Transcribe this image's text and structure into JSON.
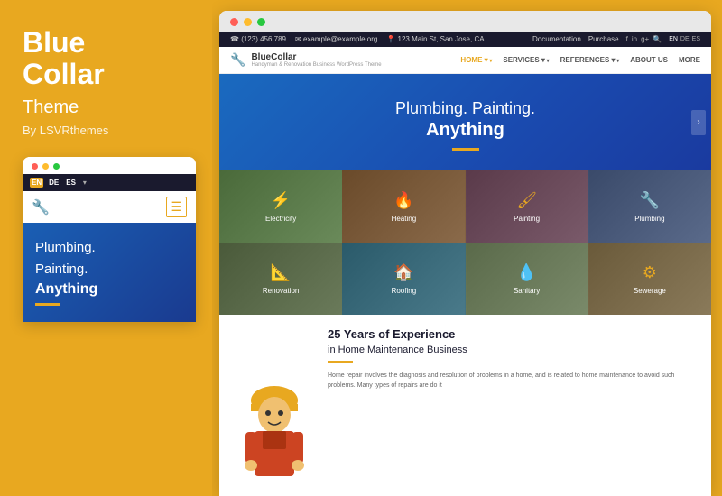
{
  "left": {
    "title_line1": "Blue",
    "title_line2": "Collar",
    "subtitle": "Theme",
    "by": "By LSVRthemes",
    "mobile": {
      "dots": [
        "red",
        "yellow",
        "green"
      ],
      "lang_options": [
        "EN",
        "DE",
        "ES"
      ],
      "active_lang": "EN",
      "hero_text1": "Plumbing.",
      "hero_text2": "Painting.",
      "hero_bold": "Anything"
    }
  },
  "browser": {
    "dots": [
      "red",
      "yellow",
      "green"
    ],
    "info_bar": {
      "phone": "☎ (123) 456 789",
      "email": "✉ example@example.org",
      "address": "📍 123 Main St, San Jose, CA",
      "links": [
        "Documentation",
        "Purchase"
      ],
      "social": [
        "f",
        "in",
        "8+",
        "🔍"
      ],
      "lang": [
        "EN",
        "DE",
        "ES"
      ]
    },
    "nav": {
      "logo_name": "BlueCollar",
      "logo_tagline": "Handyman & Renovation Business WordPress Theme",
      "links": [
        {
          "label": "HOME",
          "active": true,
          "arrow": true
        },
        {
          "label": "SERVICES",
          "active": false,
          "arrow": true
        },
        {
          "label": "REFERENCES",
          "active": false,
          "arrow": true
        },
        {
          "label": "ABOUT US",
          "active": false,
          "arrow": false
        },
        {
          "label": "MORE",
          "active": false,
          "arrow": false
        }
      ]
    },
    "hero": {
      "heading": "Plumbing. Painting.",
      "heading_bold": "Anything"
    },
    "services": [
      {
        "id": "electricity",
        "label": "Electricity",
        "icon": "⚡",
        "bg": "electricity"
      },
      {
        "id": "heating",
        "label": "Heating",
        "icon": "🔥",
        "bg": "heating"
      },
      {
        "id": "painting",
        "label": "Painting",
        "icon": "🎨",
        "bg": "painting"
      },
      {
        "id": "plumbing",
        "label": "Plumbing",
        "icon": "🔧",
        "bg": "plumbing"
      },
      {
        "id": "renovation",
        "label": "Renovation",
        "icon": "📐",
        "bg": "renovation"
      },
      {
        "id": "roofing",
        "label": "Roofing",
        "icon": "🏠",
        "bg": "roofing"
      },
      {
        "id": "sanitary",
        "label": "Sanitary",
        "icon": "💧",
        "bg": "sanitary"
      },
      {
        "id": "sewerage",
        "label": "Sewerage",
        "icon": "⚙",
        "bg": "sewerage"
      }
    ],
    "experience": {
      "title": "25 Years of Experience",
      "subtitle": "in Home Maintenance Business",
      "body": "Home repair involves the diagnosis and resolution of problems in a home, and is related to home maintenance to avoid such problems. Many types of repairs are do it"
    }
  }
}
